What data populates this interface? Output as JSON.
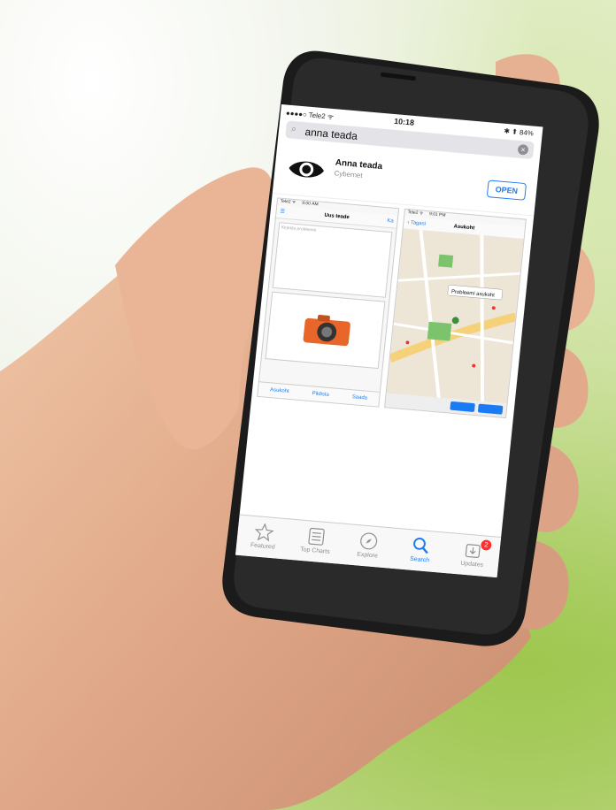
{
  "status": {
    "carrier": "●●●●○ Tele2 ᯤ",
    "time": "10:18",
    "battery": "✱ ⬆ 84%"
  },
  "search": {
    "query": "anna teada"
  },
  "app": {
    "name": "Anna teada",
    "developer": "Cybernet",
    "button_label": "OPEN"
  },
  "screenshot1": {
    "status_left": "Tele2 ᯤ",
    "status_time": "9:00 AM",
    "nav_left": "☰",
    "nav_title": "Uus teade",
    "nav_right": "Ka",
    "memo_placeholder": "Kirjelda probleemi",
    "tabs": [
      "Asukoht",
      "Pildista",
      "Saada"
    ]
  },
  "screenshot2": {
    "status_left": "Tele2 ᯤ",
    "status_time": "9:01 PM",
    "nav_left": "‹ Tagasi",
    "nav_title": "Asukoht",
    "map_label": "Probleemi asukoht"
  },
  "tabbar": {
    "items": [
      {
        "label": "Featured",
        "icon": "star-icon"
      },
      {
        "label": "Top Charts",
        "icon": "list-icon"
      },
      {
        "label": "Explore",
        "icon": "compass-icon"
      },
      {
        "label": "Search",
        "icon": "search-icon"
      },
      {
        "label": "Updates",
        "icon": "updates-icon"
      }
    ],
    "active": "Search",
    "updates_badge": "2"
  },
  "colors": {
    "accent": "#1a7cf5",
    "badge": "#ff2d2d",
    "phone_body": "#1b1b1b"
  }
}
